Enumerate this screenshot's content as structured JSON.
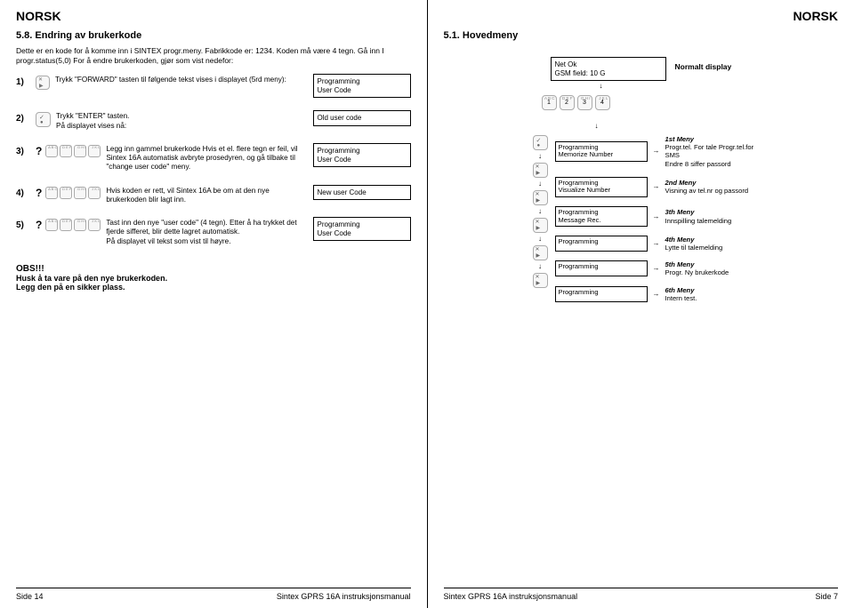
{
  "leftPage": {
    "header": "NORSK",
    "section": "5.8. Endring av brukerkode",
    "intro": "Dette er en kode for å komme inn i SINTEX progr.meny. Fabrikkode er: 1234. Koden må være 4 tegn. Gå inn I progr.status(5,0) For å endre brukerkoden, gjør som vist nedefor:",
    "steps": [
      {
        "num": "1)",
        "desc": "Trykk \"FORWARD\" tasten til følgende tekst vises i displayet (5rd meny):",
        "box": "Programming\nUser Code"
      },
      {
        "num": "2)",
        "desc": "Trykk \"ENTER\" tasten.\nPå displayet vises nå:",
        "box": "Old user code"
      },
      {
        "num": "3)",
        "desc": "Legg inn gammel brukerkode Hvis et el. flere tegn er feil, vil Sintex 16A automatisk avbryte prosedyren, og gå tilbake til \"change user code\" meny.",
        "box": "Programming\nUser Code"
      },
      {
        "num": "4)",
        "desc": "Hvis koden er rett, vil Sintex 16A be om at den nye brukerkoden blir lagt inn.",
        "box": "New user Code"
      },
      {
        "num": "5)",
        "desc": "Tast inn den nye \"user code\" (4 tegn). Etter å ha trykket det fjerde sifferet, blir dette lagret automatisk.\nPå displayet vil tekst som vist til høyre.",
        "box": "Programming\nUser Code"
      }
    ],
    "obs": "OBS!!!",
    "obs2a": "Husk å ta vare på den nye brukerkoden.",
    "obs2b": "Legg den på en sikker plass.",
    "footerLeft": "Side 14",
    "footerCenter": "Sintex GPRS 16A instruksjonsmanual"
  },
  "rightPage": {
    "header": "NORSK",
    "section": "5.1. Hovedmeny",
    "topBox": "Net Ok\nGSM field: 10      G",
    "topLabel": "Normalt display",
    "keypad": [
      "1",
      "2",
      "3",
      "4"
    ],
    "keypadSup": [
      "A B C",
      "D E F",
      "G H I",
      "J K L"
    ],
    "menus": [
      {
        "box": "Programming\nMemorize Number",
        "title": "1st Meny",
        "desc": "Progr.tel. For tale Progr.tel.for SMS\nEndre 8 siffer passord"
      },
      {
        "box": "Programming\nVisualize Number",
        "title": "2nd Meny",
        "desc": "Visning av tel.nr og passord"
      },
      {
        "box": "Programming\nMessage Rec.",
        "title": "3th Meny",
        "desc": "Innspilling talemelding"
      },
      {
        "box": "Programming",
        "title": "4th Meny",
        "desc": "Lytte til talemelding"
      },
      {
        "box": "Programming",
        "title": "5th Meny",
        "desc": "Progr. Ny brukerkode"
      },
      {
        "box": "Programming",
        "title": "6th Meny",
        "desc": "Intern test."
      }
    ],
    "footerLeft": "Sintex GPRS 16A instruksjonsmanual",
    "footerRight": "Side 7"
  }
}
